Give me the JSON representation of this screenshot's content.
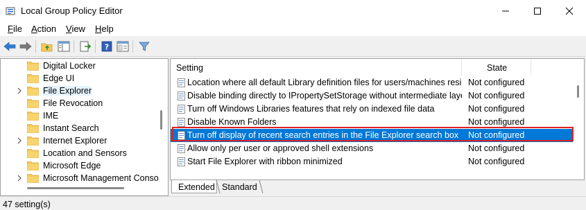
{
  "window": {
    "title": "Local Group Policy Editor"
  },
  "menu": {
    "file": {
      "underline": "F",
      "rest": "ile"
    },
    "action": {
      "underline": "A",
      "rest": "ction"
    },
    "view": {
      "underline": "V",
      "rest": "iew"
    },
    "help": {
      "underline": "H",
      "rest": "elp"
    }
  },
  "toolbar": {
    "icons": [
      "back-icon",
      "forward-icon",
      "up-folder-icon",
      "show-hide-tree-icon",
      "export-list-icon",
      "help-icon",
      "properties-icon",
      "filter-icon"
    ]
  },
  "tree": {
    "items": [
      {
        "label": "Digital Locker",
        "expandable": false
      },
      {
        "label": "Edge UI",
        "expandable": false
      },
      {
        "label": "File Explorer",
        "expandable": true,
        "selected": true
      },
      {
        "label": "File Revocation",
        "expandable": false
      },
      {
        "label": "IME",
        "expandable": false
      },
      {
        "label": "Instant Search",
        "expandable": false
      },
      {
        "label": "Internet Explorer",
        "expandable": true
      },
      {
        "label": "Location and Sensors",
        "expandable": false
      },
      {
        "label": "Microsoft Edge",
        "expandable": false
      },
      {
        "label": "Microsoft Management Conso",
        "expandable": true
      }
    ]
  },
  "list": {
    "columns": {
      "setting": "Setting",
      "state": "State"
    },
    "rows": [
      {
        "setting": "Location where all default Library definition files for users/machines reside.",
        "state": "Not configured"
      },
      {
        "setting": "Disable binding directly to IPropertySetStorage without intermediate laye...",
        "state": "Not configured"
      },
      {
        "setting": "Turn off Windows Libraries features that rely on indexed file data",
        "state": "Not configured"
      },
      {
        "setting": "Disable Known Folders",
        "state": "Not configured"
      },
      {
        "setting": "Turn off display of recent search entries in the File Explorer search box",
        "state": "Not configured",
        "selected": true
      },
      {
        "setting": "Allow only per user or approved shell extensions",
        "state": "Not configured"
      },
      {
        "setting": "Start File Explorer with ribbon minimized",
        "state": "Not configured"
      }
    ]
  },
  "tabs": {
    "extended": "Extended",
    "standard": "Standard"
  },
  "status": {
    "text": "47 setting(s)"
  },
  "colors": {
    "selection": "#0078d7",
    "highlight_border": "#e02020",
    "folder": "#f5c95c"
  }
}
